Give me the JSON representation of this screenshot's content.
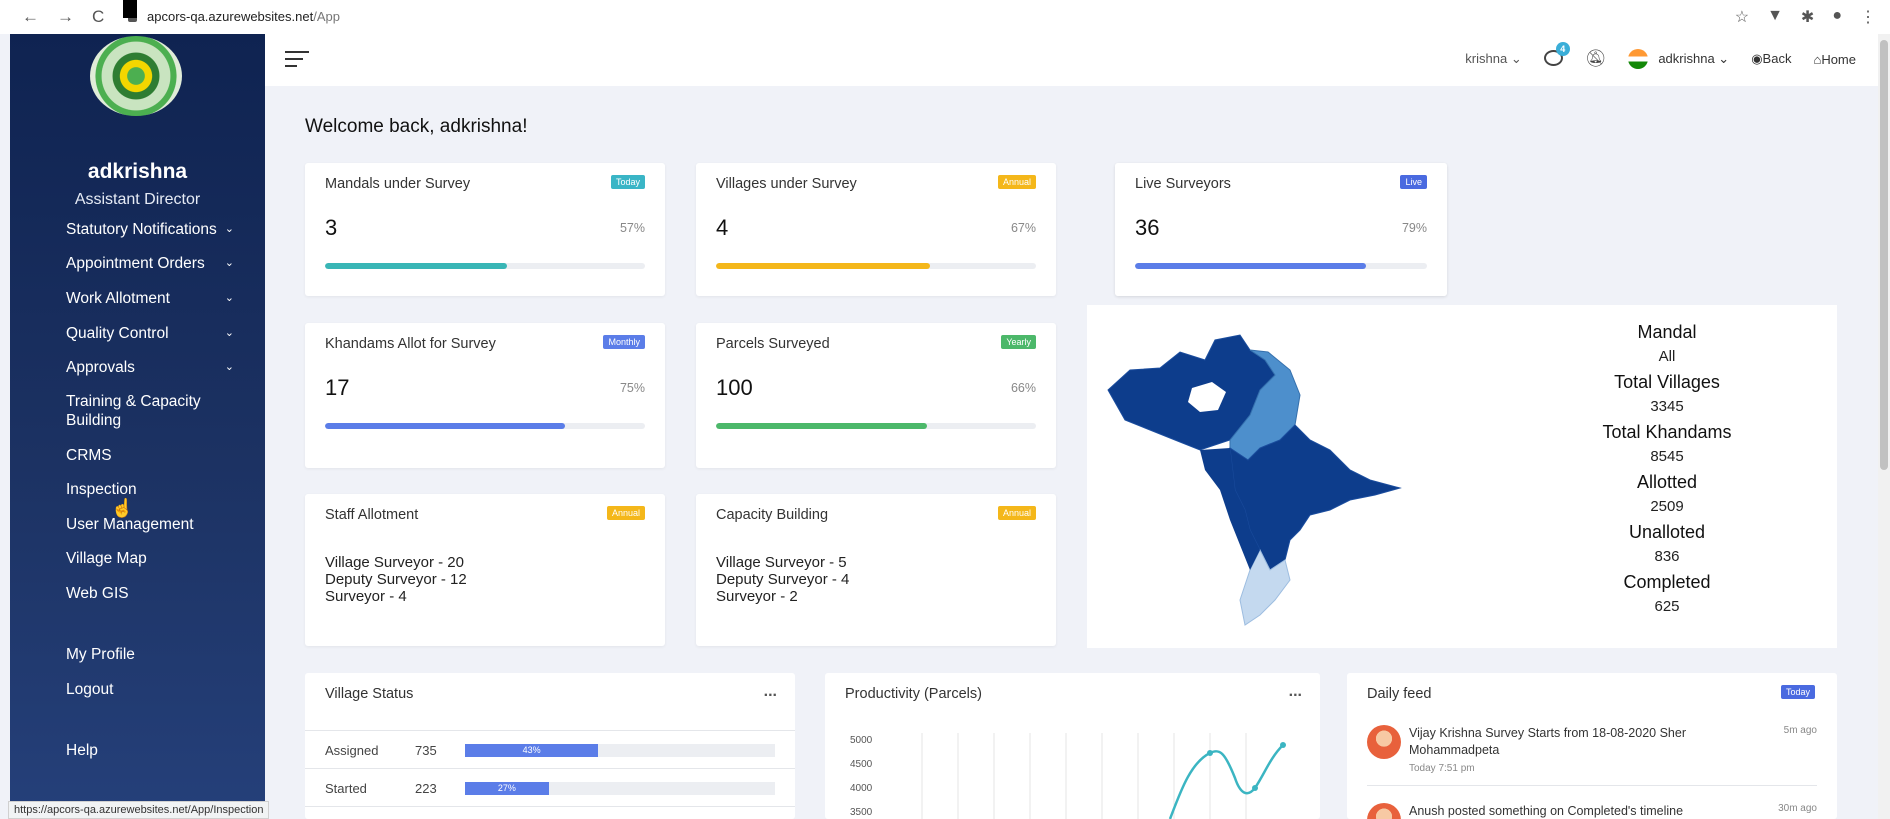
{
  "browser": {
    "host": "apcors-qa.azurewebsites.net",
    "path": "/App",
    "status_url": "https://apcors-qa.azurewebsites.net/App/Inspection"
  },
  "sidebar": {
    "user_name": "adkrishna",
    "user_role": "Assistant Director",
    "items": [
      {
        "label": "Statutory Notifications",
        "has_submenu": true
      },
      {
        "label": "Appointment Orders",
        "has_submenu": true
      },
      {
        "label": "Work Allotment",
        "has_submenu": true
      },
      {
        "label": "Quality Control",
        "has_submenu": true
      },
      {
        "label": "Approvals",
        "has_submenu": true
      },
      {
        "label": "Training & Capacity Building",
        "has_submenu": false
      },
      {
        "label": "CRMS",
        "has_submenu": false
      },
      {
        "label": "Inspection",
        "has_submenu": false
      },
      {
        "label": "User Management",
        "has_submenu": false
      },
      {
        "label": "Village Map",
        "has_submenu": false
      },
      {
        "label": "Web GIS",
        "has_submenu": false
      },
      {
        "label": "My Profile",
        "has_submenu": false
      },
      {
        "label": "Logout",
        "has_submenu": false
      },
      {
        "label": "Help",
        "has_submenu": false
      }
    ]
  },
  "topbar": {
    "district": "krishna",
    "notification_count": "4",
    "username": "adkrishna",
    "back_label": "Back",
    "home_label": "Home"
  },
  "welcome": "Welcome back, adkrishna!",
  "cards": {
    "mandals": {
      "title": "Mandals under Survey",
      "tag": "Today",
      "tag_color": "#3ab5c6",
      "value": "3",
      "percent": "57%",
      "fill": 0.57,
      "bar_color": "#39b6b6"
    },
    "villages": {
      "title": "Villages under Survey",
      "tag": "Annual",
      "tag_color": "#f4b71a",
      "value": "4",
      "percent": "67%",
      "fill": 0.67,
      "bar_color": "#f4b71a"
    },
    "surveyors": {
      "title": "Live Surveyors",
      "tag": "Live",
      "tag_color": "#4a6ae0",
      "value": "36",
      "percent": "79%",
      "fill": 0.79,
      "bar_color": "#5b7de8"
    },
    "khandams": {
      "title": "Khandams Allot for Survey",
      "tag": "Monthly",
      "tag_color": "#5b7de8",
      "value": "17",
      "percent": "75%",
      "fill": 0.75,
      "bar_color": "#5b7de8"
    },
    "parcels": {
      "title": "Parcels Surveyed",
      "tag": "Yearly",
      "tag_color": "#4cb86a",
      "value": "100",
      "percent": "66%",
      "fill": 0.66,
      "bar_color": "#4cb86a"
    },
    "staff": {
      "title": "Staff Allotment",
      "tag": "Annual",
      "tag_color": "#f4b71a",
      "lines": [
        "Village Surveyor - 20",
        "Deputy Surveyor - 12",
        "Surveyor - 4"
      ]
    },
    "capacity": {
      "title": "Capacity Building",
      "tag": "Annual",
      "tag_color": "#f4b71a",
      "lines": [
        "Village Surveyor - 5",
        "Deputy Surveyor - 4",
        "Surveyor - 2"
      ]
    }
  },
  "map_stats": [
    {
      "label": "Mandal",
      "value": "All"
    },
    {
      "label": "Total Villages",
      "value": "3345"
    },
    {
      "label": "Total Khandams",
      "value": "8545"
    },
    {
      "label": "Allotted",
      "value": "2509"
    },
    {
      "label": "Unalloted",
      "value": "836"
    },
    {
      "label": "Completed",
      "value": "625"
    }
  ],
  "village_status": {
    "title": "Village Status",
    "menu": "...",
    "rows": [
      {
        "label": "Assigned",
        "count": "735",
        "percent": "43%",
        "fill": 0.43
      },
      {
        "label": "Started",
        "count": "223",
        "percent": "27%",
        "fill": 0.27
      }
    ]
  },
  "productivity": {
    "title": "Productivity (Parcels)",
    "menu": "...",
    "ticks": [
      "5000",
      "4500",
      "4000",
      "3500"
    ]
  },
  "daily_feed": {
    "title": "Daily feed",
    "tag": "Today",
    "items": [
      {
        "text": "Vijay Krishna Survey Starts from 18-08-2020 Sher Mohammadpeta",
        "time": "Today 7:51 pm",
        "ago": "5m ago"
      },
      {
        "text": "Anush posted something on Completed's timeline",
        "time": "",
        "ago": "30m ago"
      }
    ]
  },
  "colors": {
    "sidebar": "#1c3263",
    "accent": "#5b7de8",
    "map_dark": "#0d3d8c",
    "map_mid": "#4d8fcc",
    "map_light": "#c4d9ef",
    "line": "#3bb5c2"
  }
}
